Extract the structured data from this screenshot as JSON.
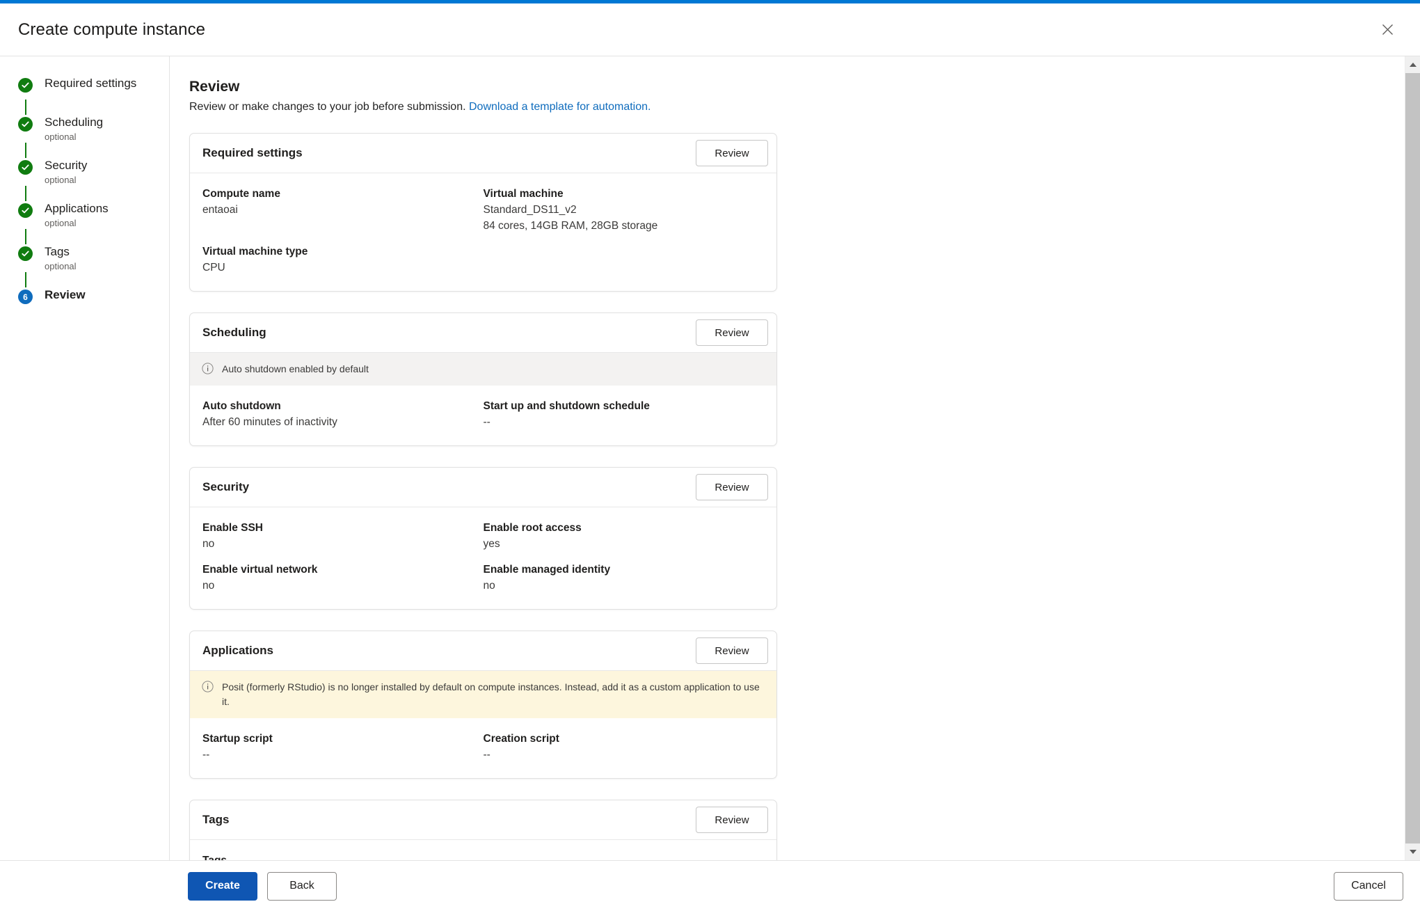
{
  "window": {
    "title": "Create compute instance",
    "close_icon": "close-icon",
    "accent_color": "#0078d4"
  },
  "sidebar": {
    "steps": [
      {
        "label": "Required settings",
        "sub": "",
        "state": "done",
        "marker": "check-icon"
      },
      {
        "label": "Scheduling",
        "sub": "optional",
        "state": "done",
        "marker": "check-icon"
      },
      {
        "label": "Security",
        "sub": "optional",
        "state": "done",
        "marker": "check-icon"
      },
      {
        "label": "Applications",
        "sub": "optional",
        "state": "done",
        "marker": "check-icon"
      },
      {
        "label": "Tags",
        "sub": "optional",
        "state": "done",
        "marker": "check-icon"
      },
      {
        "label": "Review",
        "sub": "",
        "state": "current",
        "marker": "6"
      }
    ],
    "done_color": "#107c10",
    "current_color": "#0f6cbd"
  },
  "main": {
    "heading": "Review",
    "description_prefix": "Review or make changes to your job before submission. ",
    "description_link": "Download a template for automation.",
    "cards": [
      {
        "title": "Required settings",
        "review_label": "Review",
        "banner": null,
        "fields": [
          {
            "label": "Compute name",
            "value": "entaoai"
          },
          {
            "label": "Virtual machine",
            "value": "Standard_DS11_v2",
            "value2": "84 cores, 14GB RAM, 28GB storage"
          },
          {
            "label": "Virtual machine type",
            "value": "CPU"
          },
          {
            "label": "",
            "value": ""
          }
        ]
      },
      {
        "title": "Scheduling",
        "review_label": "Review",
        "banner": {
          "kind": "info",
          "icon": "info-icon",
          "text": "Auto shutdown enabled by default"
        },
        "fields": [
          {
            "label": "Auto shutdown",
            "value": "After 60 minutes of inactivity"
          },
          {
            "label": "Start up and shutdown schedule",
            "value": "--"
          }
        ]
      },
      {
        "title": "Security",
        "review_label": "Review",
        "banner": null,
        "fields": [
          {
            "label": "Enable SSH",
            "value": "no"
          },
          {
            "label": "Enable root access",
            "value": "yes"
          },
          {
            "label": "Enable virtual network",
            "value": "no"
          },
          {
            "label": "Enable managed identity",
            "value": "no"
          }
        ]
      },
      {
        "title": "Applications",
        "review_label": "Review",
        "banner": {
          "kind": "warn",
          "icon": "info-icon",
          "text": "Posit (formerly RStudio) is no longer installed by default on compute instances.  Instead, add it as a custom application to use it."
        },
        "fields": [
          {
            "label": "Startup script",
            "value": "--"
          },
          {
            "label": "Creation script",
            "value": "--"
          }
        ]
      },
      {
        "title": "Tags",
        "review_label": "Review",
        "banner": null,
        "fields": [
          {
            "label": "Tags",
            "value": "--"
          }
        ]
      }
    ]
  },
  "footer": {
    "create_label": "Create",
    "back_label": "Back",
    "cancel_label": "Cancel",
    "primary_color": "#0f56b3"
  },
  "scrollbar": {
    "up_icon": "chevron-up-icon",
    "down_icon": "chevron-down-icon"
  }
}
